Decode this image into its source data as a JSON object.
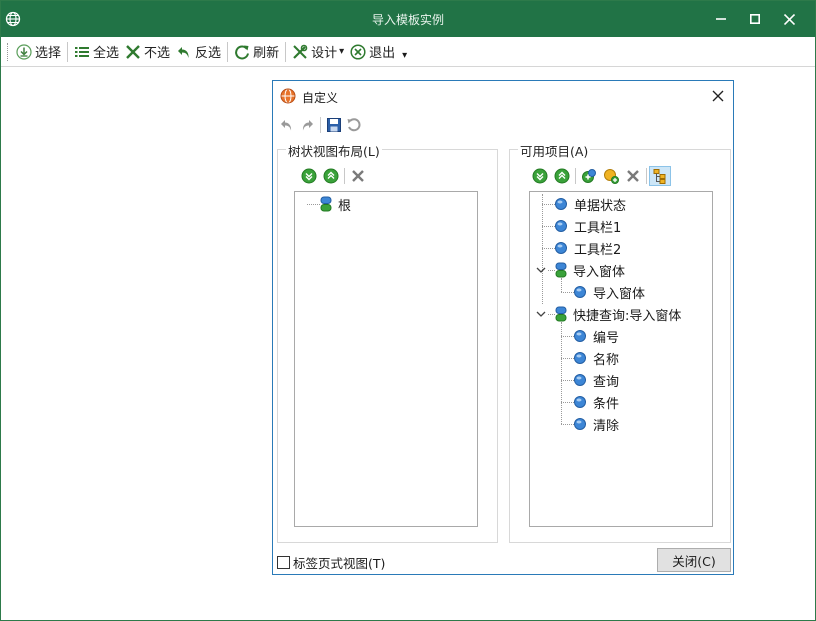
{
  "window": {
    "title": "导入模板实例",
    "controls": {
      "minimize": "—",
      "maximize": "☐",
      "close": "✕"
    }
  },
  "toolbar": {
    "items": [
      {
        "id": "select",
        "label": "选择",
        "icon": "import-icon"
      },
      {
        "id": "select-all",
        "label": "全选",
        "icon": "list-icon"
      },
      {
        "id": "select-none",
        "label": "不选",
        "icon": "x-icon"
      },
      {
        "id": "invert",
        "label": "反选",
        "icon": "undo-arrow-icon"
      },
      {
        "id": "refresh",
        "label": "刷新",
        "icon": "refresh-icon"
      },
      {
        "id": "design",
        "label": "设计",
        "icon": "tools-icon",
        "dropdown": "▾"
      },
      {
        "id": "exit",
        "label": "退出",
        "icon": "circle-x-icon"
      }
    ],
    "overflow": "▾"
  },
  "dialog": {
    "title": "自定义",
    "left_group": {
      "label": "树状视图布局(L)",
      "tree": [
        {
          "label": "根",
          "icon": "container-node-icon"
        }
      ]
    },
    "right_group": {
      "label": "可用项目(A)",
      "tree": {
        "items": [
          {
            "label": "单据状态",
            "level": 0
          },
          {
            "label": "工具栏1",
            "level": 0
          },
          {
            "label": "工具栏2",
            "level": 0
          },
          {
            "label": "导入窗体",
            "level": 0,
            "expanded": true
          },
          {
            "label": "导入窗体",
            "level": 1
          },
          {
            "label": "快捷查询:导入窗体",
            "level": 0,
            "expanded": true
          },
          {
            "label": "编号",
            "level": 1
          },
          {
            "label": "名称",
            "level": 1
          },
          {
            "label": "查询",
            "level": 1
          },
          {
            "label": "条件",
            "level": 1
          },
          {
            "label": "清除",
            "level": 1
          }
        ]
      }
    },
    "tabbed_view_checkbox": {
      "label": "标签页式视图(T)",
      "checked": false
    },
    "close_button": "关闭(C)"
  },
  "colors": {
    "title_bar": "#217346",
    "dialog_border": "#2a7ab8",
    "node_blue": "#3d86d6",
    "node_green": "#3aa23a"
  }
}
